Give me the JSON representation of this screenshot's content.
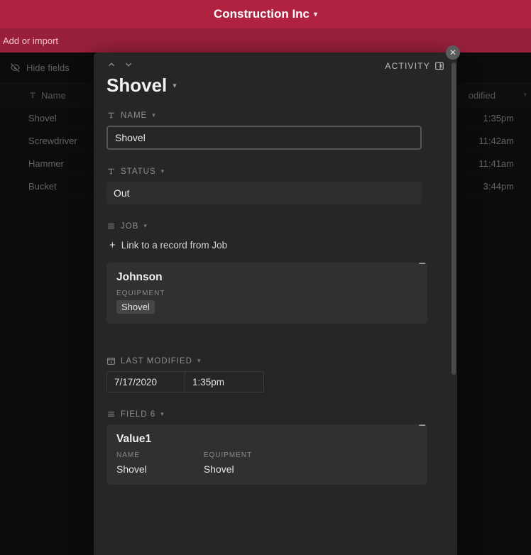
{
  "header": {
    "base_name": "Construction Inc"
  },
  "tabs": {
    "add_import": "Add or import"
  },
  "toolbar": {
    "hide_fields": "Hide fields"
  },
  "grid": {
    "columns": {
      "name": "Name",
      "modified": "odified"
    },
    "rows": [
      {
        "name": "Shovel",
        "time": "1:35pm"
      },
      {
        "name": "Screwdriver",
        "time": "11:42am"
      },
      {
        "name": "Hammer",
        "time": "11:41am"
      },
      {
        "name": "Bucket",
        "time": "3:44pm"
      }
    ]
  },
  "record": {
    "activity_label": "ACTIVITY",
    "title": "Shovel",
    "fields": {
      "name": {
        "label": "NAME",
        "value": "Shovel"
      },
      "status": {
        "label": "STATUS",
        "value": "Out"
      },
      "job": {
        "label": "JOB",
        "link_text": "Link to a record from Job",
        "card": {
          "title": "Johnson",
          "equipment_label": "EQUIPMENT",
          "equipment_value": "Shovel"
        }
      },
      "last_modified": {
        "label": "LAST MODIFIED",
        "date": "7/17/2020",
        "time": "1:35pm"
      },
      "field6": {
        "label": "FIELD 6",
        "card": {
          "title": "Value1",
          "name_label": "NAME",
          "name_value": "Shovel",
          "equipment_label": "EQUIPMENT",
          "equipment_value": "Shovel"
        }
      }
    }
  }
}
